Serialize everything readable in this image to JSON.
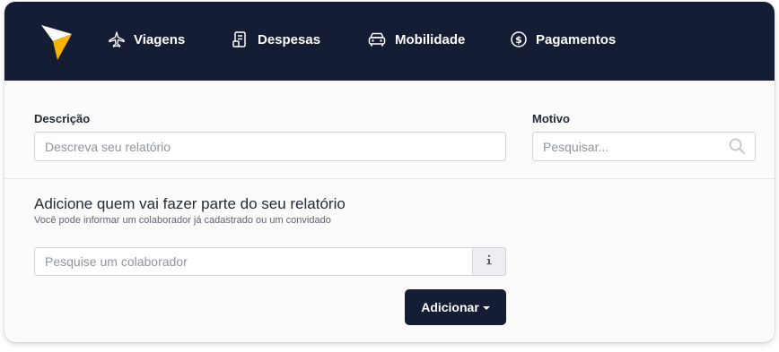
{
  "colors": {
    "navbar_bg": "#141d33",
    "logo_yellow": "#f7b500",
    "primary_button": "#141d33",
    "nav_text": "#ffffff"
  },
  "nav": {
    "items": [
      {
        "label": "Viagens",
        "icon": "airplane-icon"
      },
      {
        "label": "Despesas",
        "icon": "receipt-icon"
      },
      {
        "label": "Mobilidade",
        "icon": "car-icon"
      },
      {
        "label": "Pagamentos",
        "icon": "dollar-circle-icon"
      }
    ]
  },
  "form": {
    "descricao": {
      "label": "Descrição",
      "placeholder": "Descreva seu relatório",
      "value": ""
    },
    "motivo": {
      "label": "Motivo",
      "placeholder": "Pesquisar...",
      "value": "",
      "icon": "search-icon"
    }
  },
  "participants": {
    "title": "Adicione quem vai fazer parte do seu relatório",
    "subtitle": "Você pode informar um colaborador já cadastrado ou um convidado",
    "search": {
      "placeholder": "Pesquise um colaborador",
      "value": "",
      "addon_icon": "info-icon"
    },
    "add_button": {
      "label": "Adicionar",
      "icon": "caret-down-icon"
    }
  }
}
